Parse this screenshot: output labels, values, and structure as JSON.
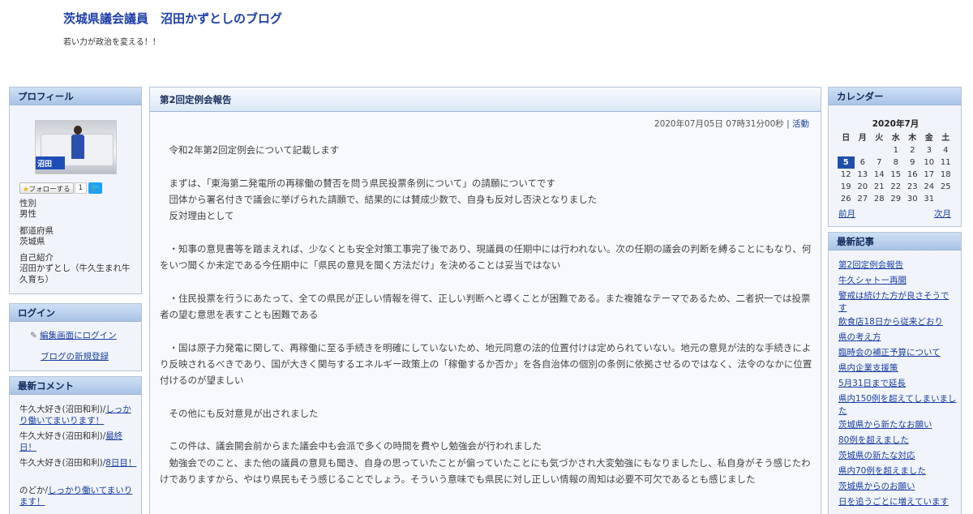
{
  "header": {
    "title": "茨城県議会議員　沼田かずとしのブログ",
    "description": "若い力が政治を変える！！"
  },
  "profile": {
    "heading": "プロフィール",
    "photo_sign": "沼田",
    "follow_label": "フォローする",
    "follow_count": "1",
    "fields": [
      {
        "label": "性別",
        "value": "男性"
      },
      {
        "label": "都道府県",
        "value": "茨城県"
      },
      {
        "label": "自己紹介",
        "value": "沼田かずとし（牛久生まれ牛久育ち）"
      }
    ]
  },
  "login": {
    "heading": "ログイン",
    "edit_link": "編集画面にログイン",
    "register_link": "ブログの新規登録"
  },
  "comments": {
    "heading": "最新コメント",
    "items": [
      {
        "author": "牛久大好き(沼田和利)/",
        "link": "しっかり働いてまいります！"
      },
      {
        "author": "牛久大好き(沼田和利)/",
        "link": "最終日！"
      },
      {
        "author": "牛久大好き(沼田和利)/",
        "link": "8日目！"
      },
      {
        "author": "のどか/",
        "link": "しっかり働いてまいります！"
      }
    ]
  },
  "entry": {
    "title": "第2回定例会報告",
    "datetime": "2020年07月05日 07時31分00秒",
    "separator": "|",
    "category": "活動",
    "paragraphs": [
      "令和2年第2回定例会について記載します",
      "",
      "まずは、「東海第二発電所の再稼働の賛否を問う県民投票条例について」の請願についてです",
      "団体から署名付きで議会に挙げられた請願で、結果的には賛成少数で、自身も反対し否決となりました",
      "反対理由として",
      "",
      "・知事の意見書等を踏まえれば、少なくとも安全対策工事完了後であり、現議員の任期中には行われない。次の任期の議会の判断を縛ることにもなり、何をいつ聞くか未定である今任期中に「県民の意見を聞く方法だけ」を決めることは妥当ではない",
      "",
      "・住民投票を行うにあたって、全ての県民が正しい情報を得て、正しい判断へと導くことが困難である。また複雑なテーマであるため、二者択一では投票者の望む意思を表すことも困難である",
      "",
      "・国は原子力発電に関して、再稼働に至る手続きを明確にしていないため、地元同意の法的位置付けは定められていない。地元の意見が法的な手続きにより反映されるべきであり、国が大きく関与するエネルギー政策上の「稼働するか否か」を各自治体の個別の条例に依拠させるのではなく、法令のなかに位置付けるのが望ましい",
      "",
      "その他にも反対意見が出されました",
      "",
      "この件は、議会開会前からまた議会中も会派で多くの時間を費やし勉強会が行われました",
      "勉強会でのこと、また他の議員の意見も聞き、自身の思っていたことが偏っていたことにも気づかされ大変勉強にもなりましたし、私自身がそう感じたわけでありますから、やはり県民もそう感じることでしょう。そういう意味でも県民に対し正しい情報の周知は必要不可欠であるとも感じました"
    ]
  },
  "calendar": {
    "heading": "カレンダー",
    "month_label": "2020年7月",
    "weekdays": [
      "日",
      "月",
      "火",
      "水",
      "木",
      "金",
      "土"
    ],
    "weeks": [
      [
        "",
        "",
        "",
        "1",
        "2",
        "3",
        "4"
      ],
      [
        "5",
        "6",
        "7",
        "8",
        "9",
        "10",
        "11"
      ],
      [
        "12",
        "13",
        "14",
        "15",
        "16",
        "17",
        "18"
      ],
      [
        "19",
        "20",
        "21",
        "22",
        "23",
        "24",
        "25"
      ],
      [
        "26",
        "27",
        "28",
        "29",
        "30",
        "31",
        ""
      ]
    ],
    "today": "5",
    "prev_label": "前月",
    "next_label": "次月"
  },
  "recent": {
    "heading": "最新記事",
    "items": [
      "第2回定例会報告",
      "牛久シャトー再開",
      "警戒は続けた方が良さそうです",
      "飲食店18日から従来どおり",
      "県の考え方",
      "臨時会の補正予算について",
      "県内企業支援策",
      "5月31日まで延長",
      "県内150例を超えてしまいました",
      "茨城県から新たなお願い",
      "80例を超えました",
      "茨城県の新たな対応",
      "県内70例を超えました",
      "茨城県からのお願い",
      "日を追うごとに増えています"
    ]
  },
  "colors": {
    "title": "#1e40a8",
    "link": "#1a3fa0",
    "box_header": "#a9c4e6",
    "today": "#1f4fa8"
  }
}
